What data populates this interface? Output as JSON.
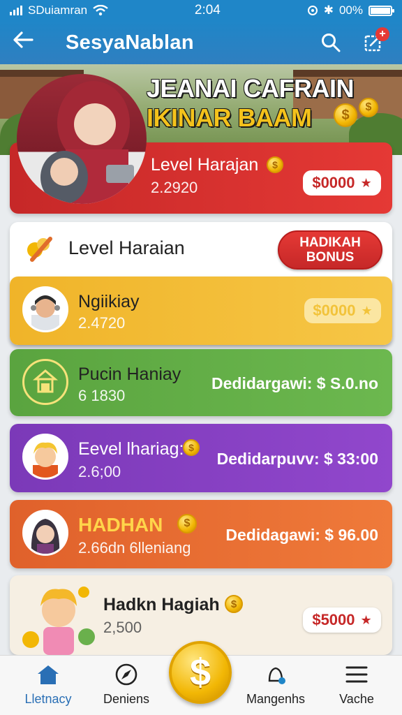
{
  "status_bar": {
    "carrier": "SDuiamran",
    "time": "2:04",
    "battery_text": "00%"
  },
  "app_bar": {
    "title": "SesyaNablan"
  },
  "hero": {
    "title_line1": "JEANAI CAFRAIN",
    "title_line2": "IKINAR BAAM"
  },
  "cards": {
    "red": {
      "title": "Level Harajan",
      "sub": "2.2920",
      "pill": "$0000"
    },
    "white": {
      "title": "Level Haraian",
      "bonus_line1": "HADIKAH",
      "bonus_line2": "BONUS"
    },
    "yellow": {
      "title": "Ngiikiay",
      "sub": "2.4720",
      "pill": "$0000"
    },
    "green": {
      "title": "Pucin Haniay",
      "sub": "6 1830",
      "reward": "Dedidargawi: $ S.0.no"
    },
    "purple": {
      "title": "Eevel lhariag:",
      "sub": "2.6;00",
      "reward": "Dedidarpuvv: $ 33:00"
    },
    "orange": {
      "title": "HADHAN",
      "sub": "2.66dn 6lleniang",
      "reward": "Dedidagawi: $ 96.00"
    },
    "cream": {
      "title": "Hadkn Hagiah",
      "sub": "2,500",
      "pill": "$5000"
    }
  },
  "bottom_nav": [
    {
      "label": "Lletnacy",
      "icon": "home-icon"
    },
    {
      "label": "Deniens",
      "icon": "compass-icon"
    },
    {
      "label": "Mangenhs",
      "icon": "bell-icon"
    },
    {
      "label": "Vache",
      "icon": "menu-icon"
    }
  ],
  "colors": {
    "primary": "#1f86c8",
    "red": "#e53935",
    "yellow": "#f0b429",
    "green": "#5aa43f",
    "purple": "#7b39b8",
    "orange": "#e0612b",
    "coin": "#f2b705"
  }
}
